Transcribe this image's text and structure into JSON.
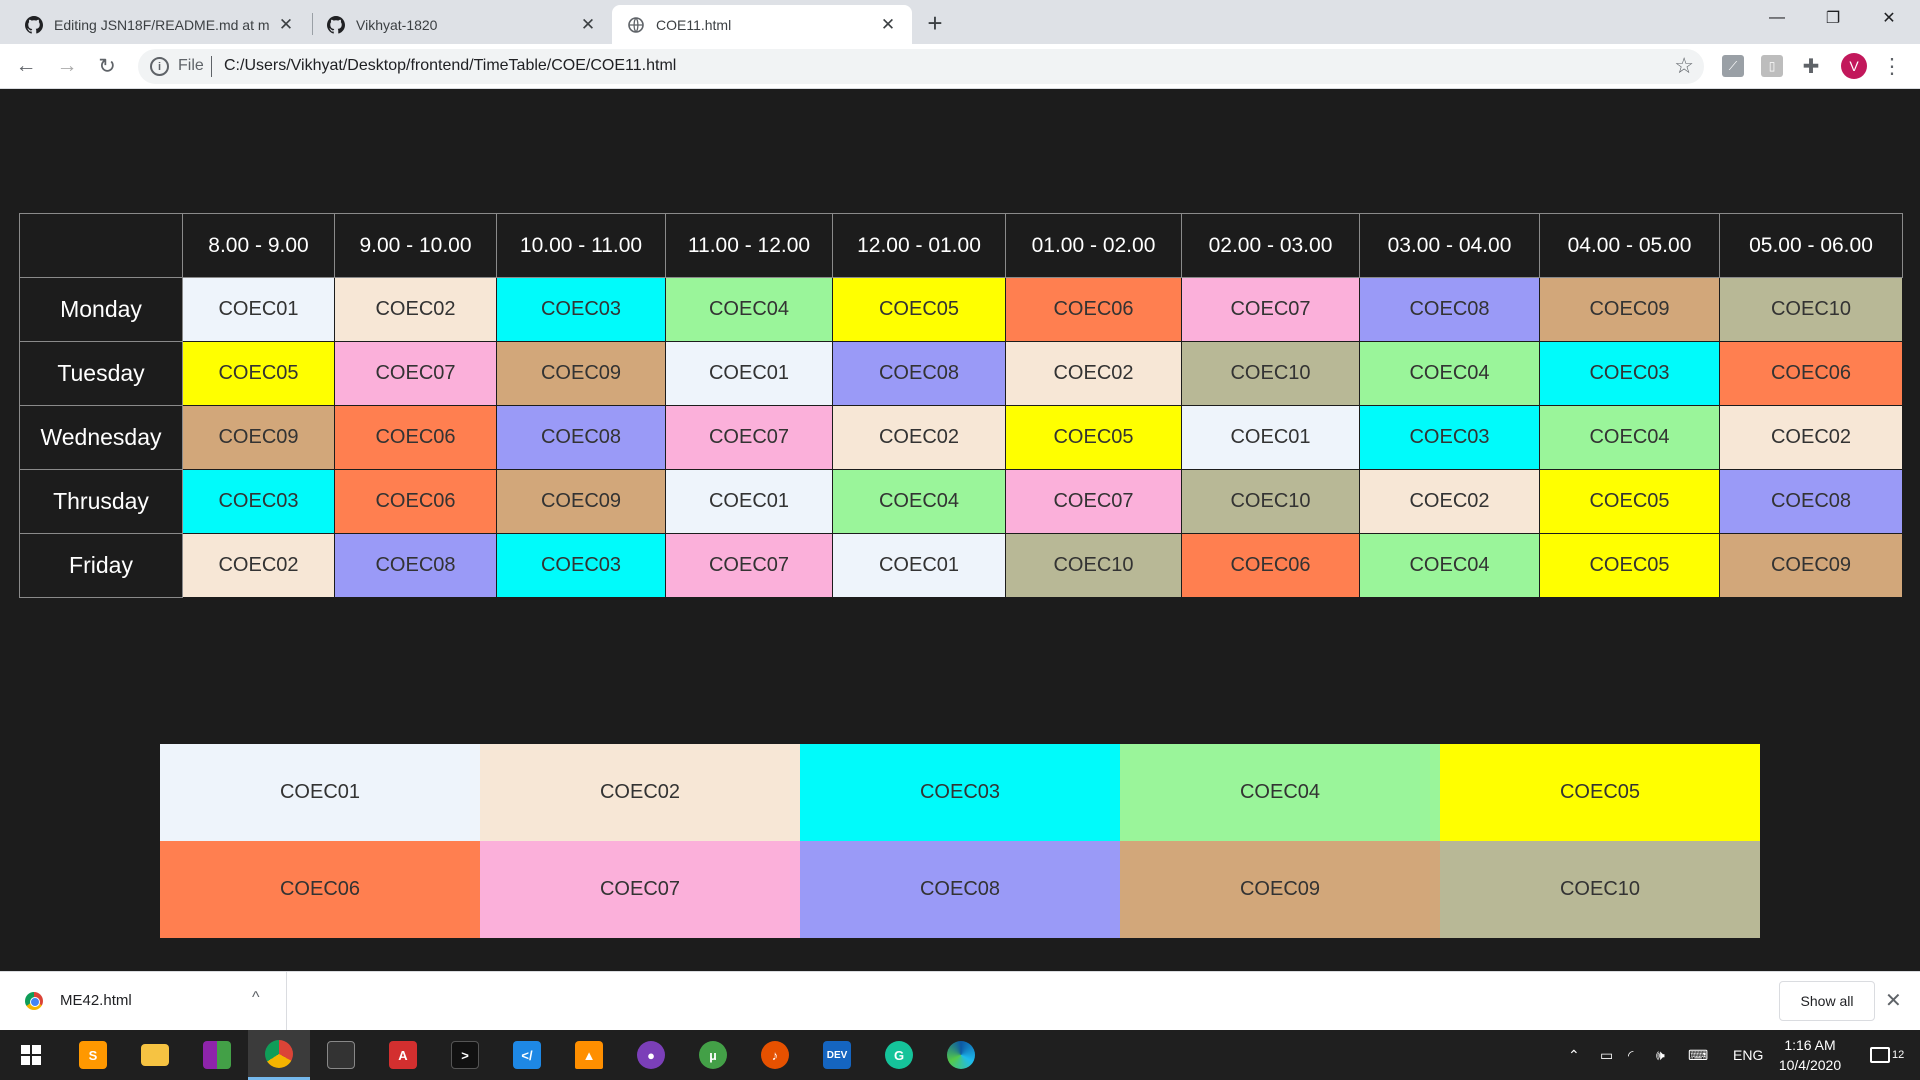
{
  "browser": {
    "tabs": [
      {
        "title": "Editing JSN18F/README.md at m",
        "icon": "github-icon"
      },
      {
        "title": "Vikhyat-1820",
        "icon": "github-icon"
      },
      {
        "title": "COE11.html",
        "icon": "globe-icon"
      }
    ],
    "new_tab": "+",
    "window_controls": {
      "minimize": "—",
      "maximize": "❐",
      "close": "✕"
    },
    "toolbar": {
      "back": "←",
      "forward": "→",
      "reload": "↻",
      "info": "i",
      "scheme_label": "File",
      "url": "C:/Users/Vikhyat/Desktop/frontend/TimeTable/COE/COE11.html",
      "star": "☆",
      "profile_initial": "V",
      "menu": "⋮"
    }
  },
  "timetable": {
    "time_slots": [
      "8.00 - 9.00",
      "9.00 - 10.00",
      "10.00 - 11.00",
      "11.00 - 12.00",
      "12.00 - 01.00",
      "01.00 - 02.00",
      "02.00 - 03.00",
      "03.00 - 04.00",
      "04.00 - 05.00",
      "05.00 - 06.00"
    ],
    "days": [
      {
        "day": "Monday",
        "cells": [
          "COEC01",
          "COEC02",
          "COEC03",
          "COEC04",
          "COEC05",
          "COEC06",
          "COEC07",
          "COEC08",
          "COEC09",
          "COEC10"
        ]
      },
      {
        "day": "Tuesday",
        "cells": [
          "COEC05",
          "COEC07",
          "COEC09",
          "COEC01",
          "COEC08",
          "COEC02",
          "COEC10",
          "COEC04",
          "COEC03",
          "COEC06"
        ]
      },
      {
        "day": "Wednesday",
        "cells": [
          "COEC09",
          "COEC06",
          "COEC08",
          "COEC07",
          "COEC02",
          "COEC05",
          "COEC01",
          "COEC03",
          "COEC04",
          "COEC02"
        ]
      },
      {
        "day": "Thrusday",
        "cells": [
          "COEC03",
          "COEC06",
          "COEC09",
          "COEC01",
          "COEC04",
          "COEC07",
          "COEC10",
          "COEC02",
          "COEC05",
          "COEC08"
        ]
      },
      {
        "day": "Friday",
        "cells": [
          "COEC02",
          "COEC08",
          "COEC03",
          "COEC07",
          "COEC01",
          "COEC10",
          "COEC06",
          "COEC04",
          "COEC05",
          "COEC09"
        ]
      }
    ]
  },
  "subject_colors": {
    "COEC01": "#eef4fb",
    "COEC02": "#f7e7d6",
    "COEC03": "#00fbfb",
    "COEC04": "#9af59a",
    "COEC05": "#ffff00",
    "COEC06": "#ff7f50",
    "COEC07": "#fbb0da",
    "COEC08": "#9a9af7",
    "COEC09": "#d2a77a",
    "COEC10": "#b8b896"
  },
  "legend": [
    "COEC01",
    "COEC02",
    "COEC03",
    "COEC04",
    "COEC05",
    "COEC06",
    "COEC07",
    "COEC08",
    "COEC09",
    "COEC10"
  ],
  "downloads": {
    "file_name": "ME42.html",
    "caret": "^",
    "show_all": "Show all",
    "close": "✕"
  },
  "taskbar": {
    "apps": [
      "windows-start-icon",
      "sublime-text-icon",
      "file-explorer-icon",
      "winrar-icon",
      "chrome-icon",
      "terminal-icon",
      "acrobat-icon",
      "powershell-icon",
      "vscode-icon",
      "vlc-icon",
      "github-desktop-icon",
      "utorrent-icon",
      "fl-studio-icon",
      "dev-cpp-icon",
      "grammarly-icon",
      "edge-icon"
    ],
    "dev_label": "DEV",
    "language": "ENG",
    "time": "1:16 AM",
    "date": "10/4/2020",
    "notifications": "12"
  }
}
